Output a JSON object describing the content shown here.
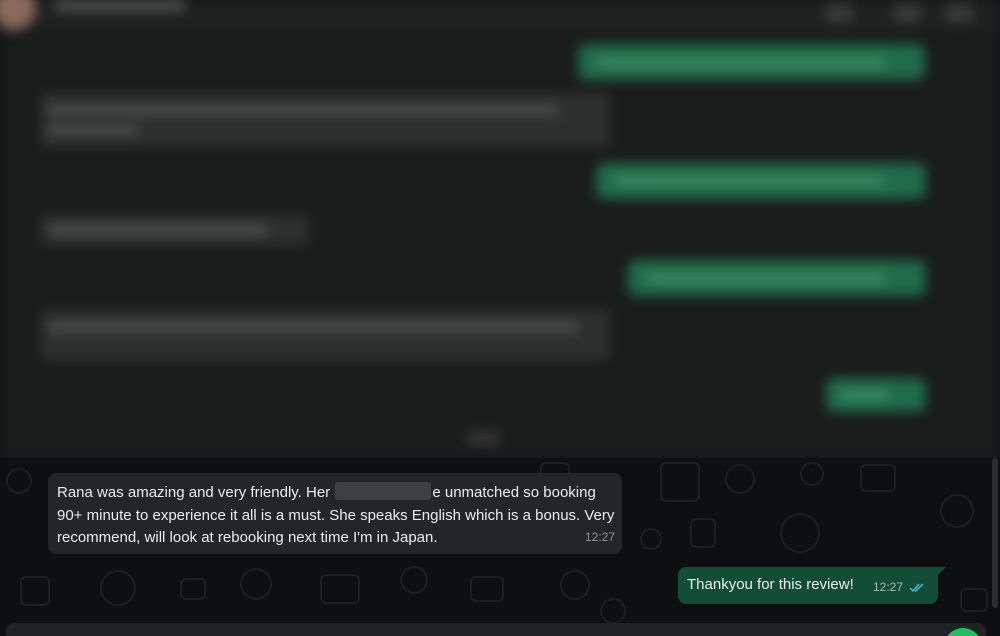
{
  "chat": {
    "incoming": {
      "text_part1": "Rana was amazing and very friendly. Her",
      "text_part2": "e unmatched so booking 90+ minute to experience it all is a must. She speaks English which is a bonus. Very recommend, will look at rebooking next time I'm in Japan.",
      "time": "12:27"
    },
    "outgoing": {
      "text": "Thankyou for this review!",
      "time": "12:27",
      "status_icon": "double-check-icon",
      "status_color": "#53bdeb"
    }
  },
  "colors": {
    "background": "#0d0f10",
    "incoming_bubble": "#232526",
    "outgoing_bubble": "#144d37",
    "accent_green": "#21c063"
  }
}
